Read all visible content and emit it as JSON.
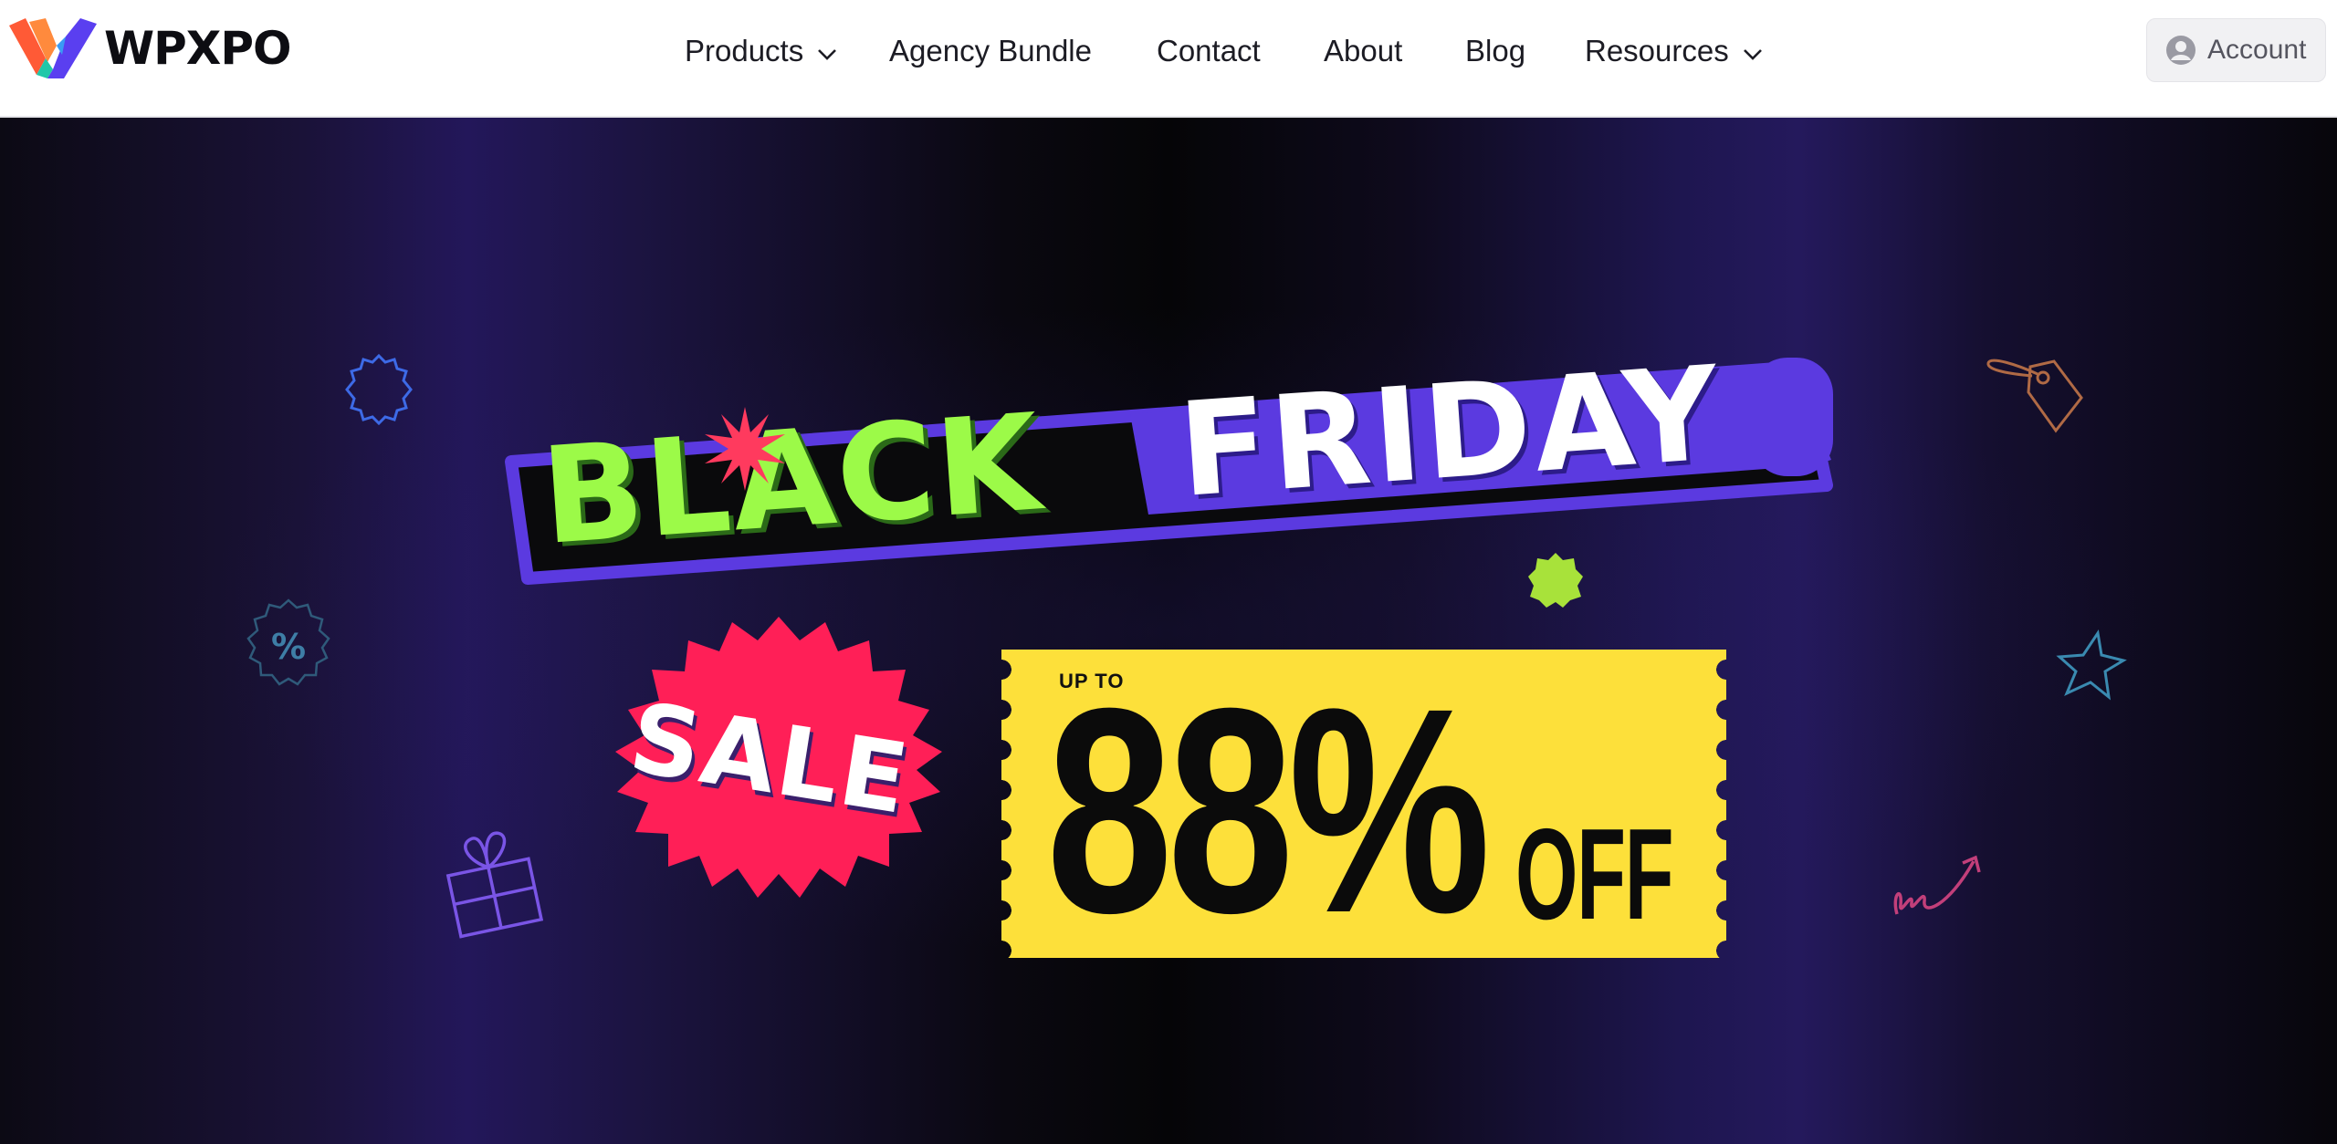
{
  "brand": {
    "name": "WPXPO"
  },
  "nav": {
    "items": [
      {
        "label": "Products",
        "has_dropdown": true
      },
      {
        "label": "Agency Bundle",
        "has_dropdown": false
      },
      {
        "label": "Contact",
        "has_dropdown": false
      },
      {
        "label": "About",
        "has_dropdown": false
      },
      {
        "label": "Blog",
        "has_dropdown": false
      },
      {
        "label": "Resources",
        "has_dropdown": true
      }
    ],
    "account_label": "Account",
    "account_icon": "user-circle-icon",
    "dropdown_icon": "chevron-down-icon"
  },
  "hero": {
    "headline_1": "BLACK",
    "headline_2": "FRIDAY",
    "sale_label": "SALE",
    "discount_prefix": "UP TO",
    "discount_value": "88%",
    "discount_suffix": "OFF",
    "colors": {
      "frame": "#5b3ae0",
      "black_word": "#9cfa48",
      "sale_badge": "#ff1f57",
      "ticket": "#fde03a"
    },
    "decor_icons": [
      "badge-outline-icon",
      "percent-badge-icon",
      "gift-icon",
      "price-tag-icon",
      "star-outline-icon",
      "squiggle-arrow-icon",
      "burst-star-icon",
      "green-burst-icon"
    ]
  }
}
